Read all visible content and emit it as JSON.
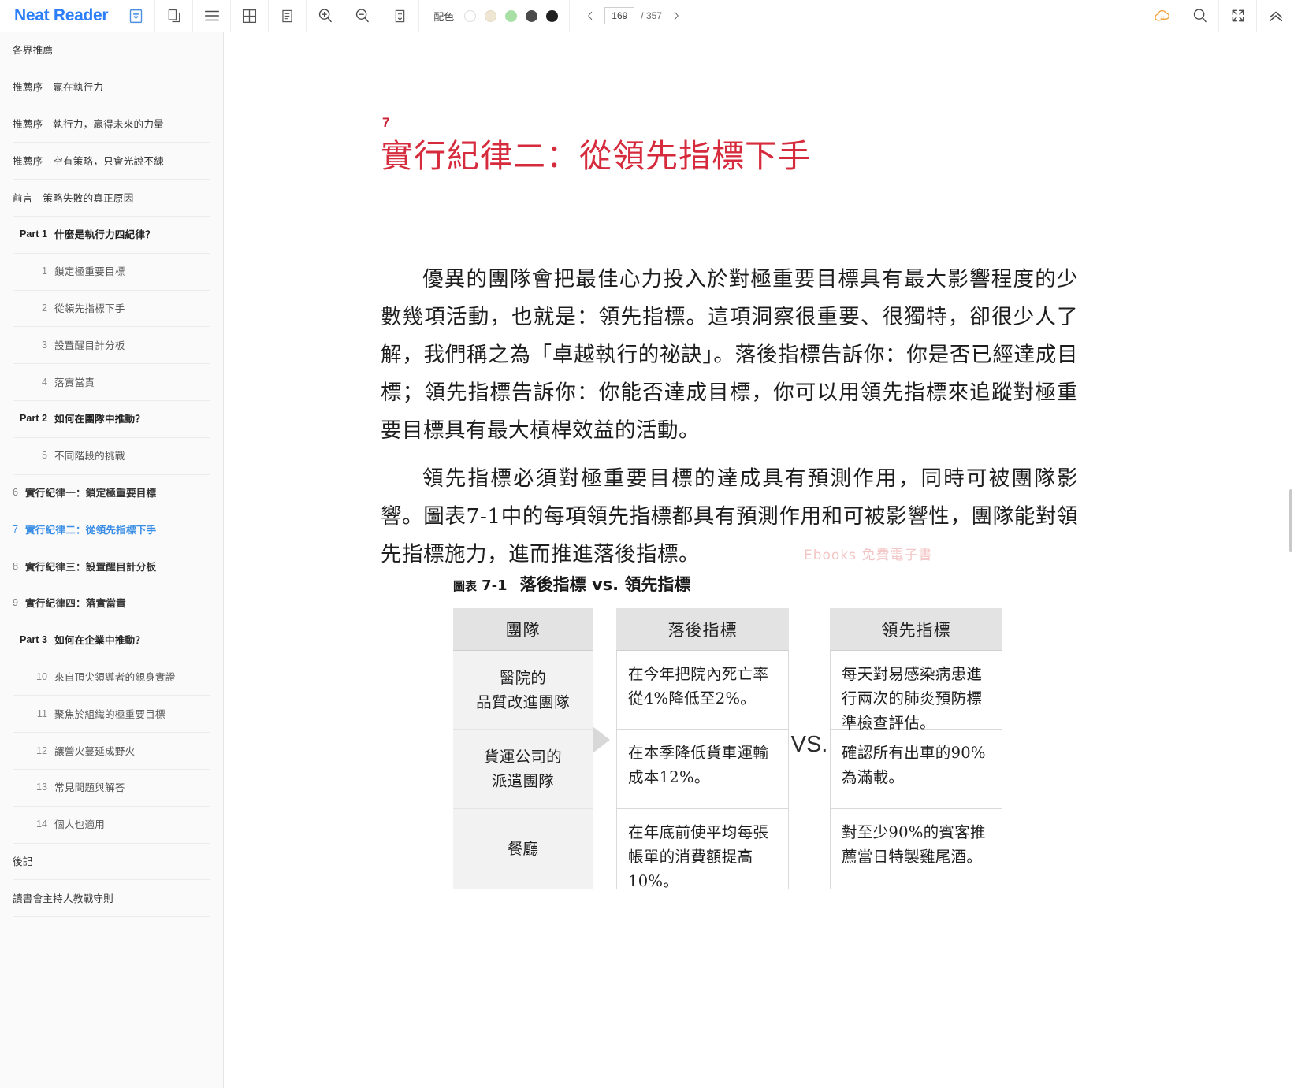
{
  "app": {
    "brand": "Neat Reader"
  },
  "toolbar": {
    "icons": {
      "library": "library-icon",
      "copy": "duplicate-icon",
      "menu": "hamburger-menu-icon",
      "grid": "grid-layout-icon",
      "single_page": "single-page-layout-icon",
      "zoom_in": "zoom-in-icon",
      "zoom_out": "zoom-out-icon",
      "fit_height": "fit-height-icon",
      "cloud": "cloud-sync-icon",
      "search": "search-icon",
      "fullscreen": "fullscreen-icon",
      "collapse": "collapse-chevrons-icon",
      "prev": "chevron-left-icon",
      "next": "chevron-right-icon"
    },
    "color_scheme": {
      "label": "配色",
      "swatches": [
        "#ffffff",
        "#efe7d3",
        "#a8dfa4",
        "#4a4a4a",
        "#1f1f1f"
      ],
      "selected_index": 0
    },
    "pager": {
      "current": "169",
      "separator": "/ 357",
      "total": "357",
      "placeholder": "169"
    }
  },
  "sidebar": {
    "items": [
      {
        "num": "",
        "label": "各界推薦",
        "level": "top",
        "active": false
      },
      {
        "num": "",
        "label": "推薦序　贏在執行力",
        "level": "top",
        "active": false
      },
      {
        "num": "",
        "label": "推薦序　執行力，贏得未來的力量",
        "level": "top",
        "active": false
      },
      {
        "num": "",
        "label": "推薦序　空有策略，只會光說不練",
        "level": "top",
        "active": false
      },
      {
        "num": "",
        "label": "前言　策略失敗的真正原因",
        "level": "top",
        "active": false
      },
      {
        "num": "Part 1",
        "label": "什麼是執行力四紀律？",
        "level": "part",
        "active": false
      },
      {
        "num": "1",
        "label": "鎖定極重要目標",
        "level": "chap",
        "active": false
      },
      {
        "num": "2",
        "label": "從領先指標下手",
        "level": "chap",
        "active": false
      },
      {
        "num": "3",
        "label": "設置醒目計分板",
        "level": "chap",
        "active": false
      },
      {
        "num": "4",
        "label": "落實當責",
        "level": "chap",
        "active": false
      },
      {
        "num": "Part 2",
        "label": "如何在團隊中推動？",
        "level": "part",
        "active": false
      },
      {
        "num": "5",
        "label": "不同階段的挑戰",
        "level": "chap",
        "active": false
      },
      {
        "num": "6",
        "label": "實行紀律一：鎖定極重要目標",
        "level": "chap-b",
        "active": false
      },
      {
        "num": "7",
        "label": "實行紀律二：從領先指標下手",
        "level": "chap-b",
        "active": true
      },
      {
        "num": "8",
        "label": "實行紀律三：設置醒目計分板",
        "level": "chap-b",
        "active": false
      },
      {
        "num": "9",
        "label": "實行紀律四：落實當責",
        "level": "chap-b",
        "active": false
      },
      {
        "num": "Part 3",
        "label": "如何在企業中推動？",
        "level": "part",
        "active": false
      },
      {
        "num": "10",
        "label": "來自頂尖領導者的親身實證",
        "level": "chap",
        "active": false
      },
      {
        "num": "11",
        "label": "聚焦於組織的極重要目標",
        "level": "chap",
        "active": false
      },
      {
        "num": "12",
        "label": "讓營火蔓延成野火",
        "level": "chap",
        "active": false
      },
      {
        "num": "13",
        "label": "常見問題與解答",
        "level": "chap",
        "active": false
      },
      {
        "num": "14",
        "label": "個人也適用",
        "level": "chap",
        "active": false
      },
      {
        "num": "",
        "label": "後記",
        "level": "top",
        "active": false
      },
      {
        "num": "",
        "label": "讀書會主持人教戰守則",
        "level": "top",
        "active": false
      }
    ]
  },
  "content": {
    "chapter_number": "7",
    "chapter_title": "實行紀律二：從領先指標下手",
    "paragraphs": [
      "優異的團隊會把最佳心力投入於對極重要目標具有最大影響程度的少數幾項活動，也就是：領先指標。這項洞察很重要、很獨特，卻很少人了解，我們稱之為「卓越執行的祕訣」。落後指標告訴你：你是否已經達成目標；領先指標告訴你：你能否達成目標，你可以用領先指標來追蹤對極重要目標具有最大槓桿效益的活動。",
      "領先指標必須對極重要目標的達成具有預測作用，同時可被團隊影響。圖表7-1中的每項領先指標都具有預測作用和可被影響性，團隊能對領先指標施力，進而推進落後指標。"
    ],
    "watermark": "Ebooks 免費電子書",
    "figure": {
      "caption_label": "圖表",
      "caption_number": "7-1",
      "caption_title": "落後指標 vs. 領先指標",
      "vs_mark": "VS.",
      "headers": [
        "團隊",
        "落後指標",
        "領先指標"
      ],
      "rows": [
        {
          "team": "醫院的\n品質改進團隊",
          "team_line1": "醫院的",
          "team_line2": "品質改進團隊",
          "lag": "在今年把院內死亡率從4%降低至2%。",
          "lead": "每天對易感染病患進行兩次的肺炎預防標準檢查評估。"
        },
        {
          "team": "貨運公司的\n派遣團隊",
          "team_line1": "貨運公司的",
          "team_line2": "派遣團隊",
          "lag": "在本季降低貨車運輸成本12%。",
          "lead": "確認所有出車的90%為滿載。"
        },
        {
          "team": "餐廳",
          "team_line1": "餐廳",
          "team_line2": "",
          "lag": "在年底前使平均每張帳單的消費額提高10%。",
          "lead": "對至少90%的賓客推薦當日特製雞尾酒。"
        }
      ]
    }
  }
}
